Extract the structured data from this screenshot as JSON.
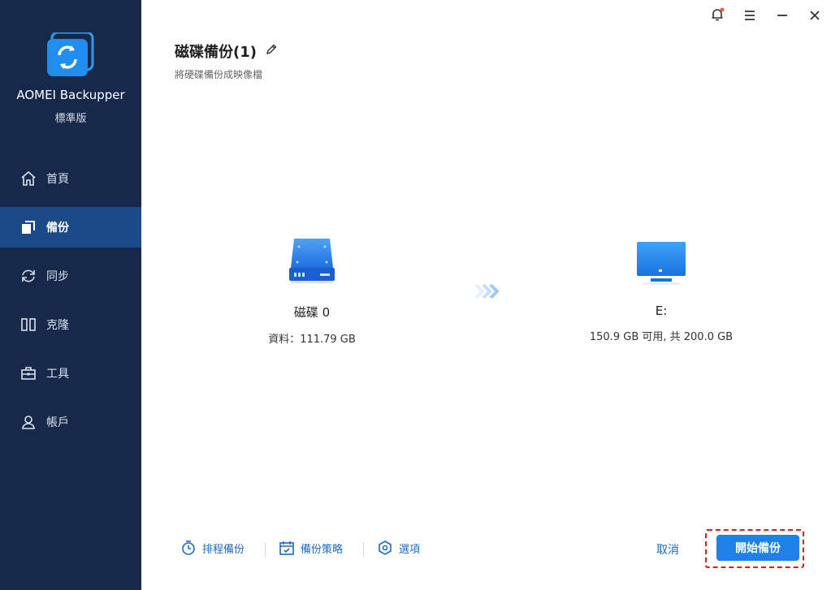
{
  "app": {
    "name": "AOMEI Backupper",
    "edition": "標準版"
  },
  "sidebar": {
    "items": [
      {
        "label": "首頁",
        "icon": "home-icon"
      },
      {
        "label": "備份",
        "icon": "backup-icon",
        "active": true
      },
      {
        "label": "同步",
        "icon": "sync-icon"
      },
      {
        "label": "克隆",
        "icon": "clone-icon"
      },
      {
        "label": "工具",
        "icon": "toolbox-icon"
      },
      {
        "label": "帳戶",
        "icon": "user-icon"
      }
    ]
  },
  "titlebar": {
    "icons": [
      "bell-icon",
      "menu-icon",
      "minimize-icon",
      "close-icon"
    ]
  },
  "page": {
    "title": "磁碟備份(1)",
    "subtitle": "將硬碟備份成映像檔"
  },
  "source": {
    "name": "磁碟 0",
    "info": "資料：111.79 GB"
  },
  "destination": {
    "name": "E:",
    "info": "150.9 GB 可用, 共 200.0 GB"
  },
  "bottom": {
    "schedule": "排程備份",
    "scheme": "備份策略",
    "options": "選項",
    "cancel": "取消",
    "start": "開始備份"
  },
  "colors": {
    "sidebar": "#16294b",
    "active": "#1c4a88",
    "accent": "#1f80e8",
    "highlight": "#e01b1b"
  }
}
